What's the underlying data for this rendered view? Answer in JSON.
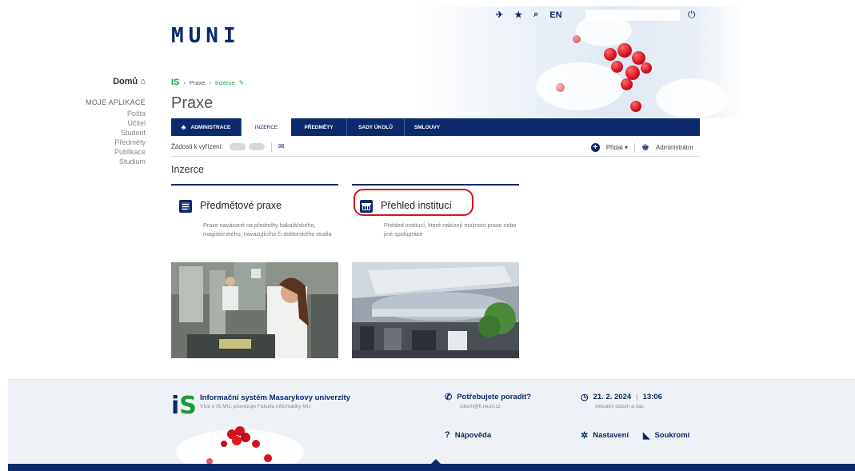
{
  "header": {
    "logo": "MUNI",
    "lang": "EN",
    "icons": [
      "pin-icon",
      "star-icon",
      "search-icon"
    ],
    "power_icon": "power-icon"
  },
  "leftnav": {
    "home": "Domů",
    "apps_heading": "MOJE APLIKACE",
    "items": [
      "Pošta",
      "Učitel",
      "Student",
      "Předměty",
      "Publikace",
      "Studium"
    ]
  },
  "breadcrumb": {
    "logo": "IS",
    "items": [
      "Praxe",
      "Inzerce"
    ]
  },
  "page_title": "Praxe",
  "tabs": [
    {
      "label": "ADMINISTRACE"
    },
    {
      "label": "INZERCE"
    },
    {
      "label": "PŘEDMĚTY"
    },
    {
      "label": "SADY ÚKOLŮ"
    },
    {
      "label": "SMLOUVY"
    }
  ],
  "toolbar": {
    "requests_label": "Žádosti k vyřízení:",
    "add_label": "Přidat",
    "admin_label": "Administrátor"
  },
  "section_heading": "Inzerce",
  "cards": [
    {
      "title": "Předmětové praxe",
      "description": "Praxe navázané na předměty bakalářského, magisterského, navazujícího či doktorského studia"
    },
    {
      "title": "Přehled institucí",
      "description": "Přehled institucí, které nabízejí možnost praxe nebo jiné spolupráce"
    }
  ],
  "footer": {
    "system_title": "Informační systém Masarykovy univerzity",
    "system_sub": "Více o IS MU, provozuje Fakulta informatiky MU",
    "help_title": "Potřebujete poradit?",
    "help_email": "istech@fi.muni.cz",
    "date": "21. 2. 2024",
    "time": "13:06",
    "date_label": "Aktuální datum a čas",
    "napoveda": "Nápověda",
    "nastaveni": "Nastavení",
    "soukromi": "Soukromí"
  },
  "colors": {
    "brand_navy": "#0b2a6b",
    "is_green": "#1a9a3a",
    "highlight_red": "#d0141e"
  }
}
